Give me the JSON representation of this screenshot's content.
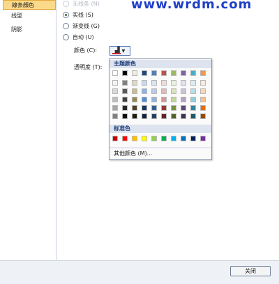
{
  "watermark": "www.wrdm.com",
  "sidebar": {
    "items": [
      {
        "label": "線条顔色",
        "active": true
      },
      {
        "label": "线型",
        "active": false
      },
      {
        "label": "阴影",
        "active": false
      }
    ]
  },
  "line_options": {
    "none": "无线条 (N)",
    "solid": "实线 (S)",
    "gradient": "渐变线 (G)",
    "auto": "自动 (U)",
    "selected": "solid"
  },
  "color_field_label": "颜色 (C):",
  "color_button": {
    "icon": "paint-bucket-icon",
    "accent": "#cc2020"
  },
  "transparency_label": "透明度 (T):",
  "palette": {
    "theme_header": "主题颜色",
    "theme_base": [
      "#ffffff",
      "#000000",
      "#eeece1",
      "#1f497d",
      "#4f81bd",
      "#c0504d",
      "#9bbb59",
      "#8064a2",
      "#4bacc6",
      "#f79646"
    ],
    "theme_shades": [
      [
        "#f2f2f2",
        "#d9d9d9",
        "#bfbfbf",
        "#a6a6a6",
        "#808080"
      ],
      [
        "#7f7f7f",
        "#595959",
        "#404040",
        "#262626",
        "#0d0d0d"
      ],
      [
        "#ddd9c3",
        "#c4bd97",
        "#948a54",
        "#4a452a",
        "#1e1c11"
      ],
      [
        "#c6d9f0",
        "#8db3e2",
        "#548dd4",
        "#17365d",
        "#0f243e"
      ],
      [
        "#dbe5f1",
        "#b8cce4",
        "#95b3d7",
        "#366092",
        "#244061"
      ],
      [
        "#f2dcdb",
        "#e5b9b7",
        "#d99694",
        "#953734",
        "#632423"
      ],
      [
        "#ebf1dd",
        "#d7e3bc",
        "#c3d69b",
        "#76923c",
        "#4f6128"
      ],
      [
        "#e5e0ec",
        "#ccc1d9",
        "#b2a2c7",
        "#5f497a",
        "#3f3151"
      ],
      [
        "#dbeef3",
        "#b7dde8",
        "#92cddc",
        "#31859b",
        "#205867"
      ],
      [
        "#fdeada",
        "#fbd5b5",
        "#fac08f",
        "#e36c09",
        "#974806"
      ]
    ],
    "standard_header": "标准色",
    "standard": [
      "#c00000",
      "#ff0000",
      "#ffc000",
      "#ffff00",
      "#92d050",
      "#00b050",
      "#00b0f0",
      "#0070c0",
      "#002060",
      "#7030a0"
    ],
    "more_colors": "其他颜色 (M)..."
  },
  "close_label": "关闭"
}
